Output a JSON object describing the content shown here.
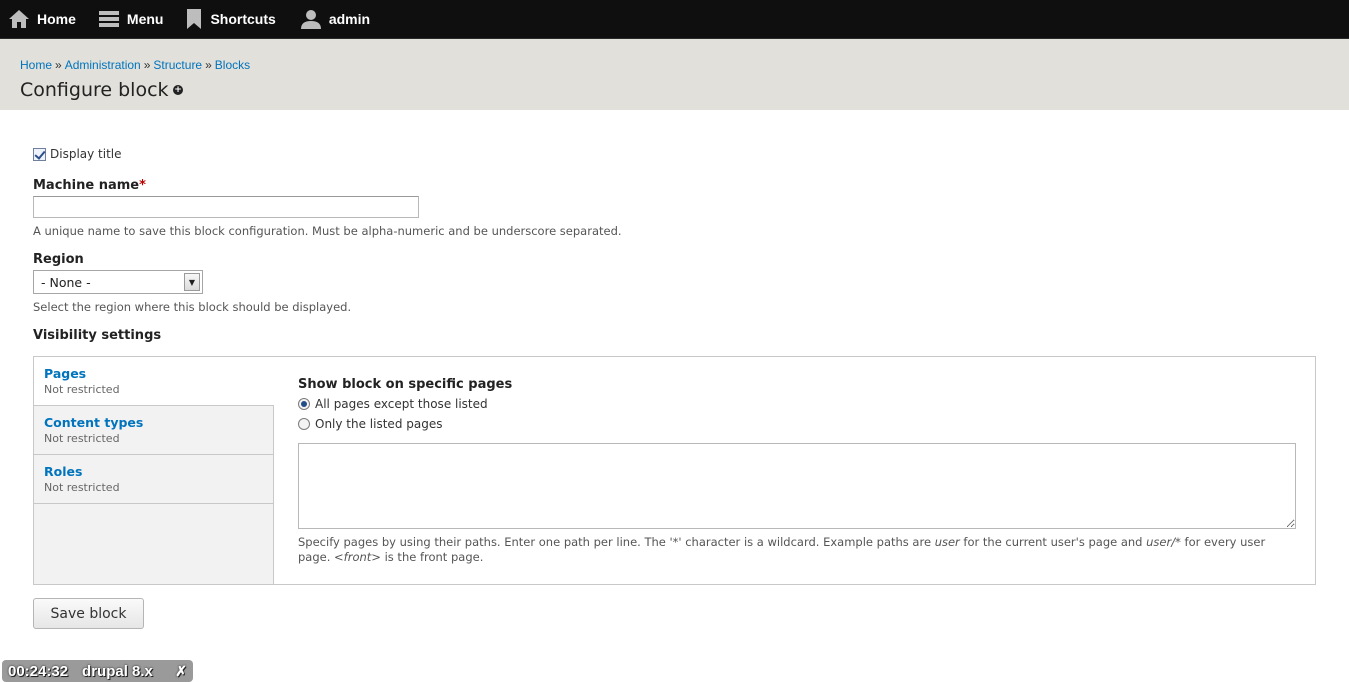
{
  "toolbar": {
    "home": "Home",
    "menu": "Menu",
    "shortcuts": "Shortcuts",
    "user": "admin"
  },
  "breadcrumb": [
    "Home",
    "Administration",
    "Structure",
    "Blocks"
  ],
  "breadcrumb_separator": "»",
  "page_title": "Configure block",
  "form": {
    "display_title_label": "Display title",
    "display_title_checked": true,
    "machine_name_label": "Machine name",
    "required_marker": "*",
    "machine_name_value": "",
    "machine_name_desc": "A unique name to save this block configuration. Must be alpha-numeric and be underscore separated.",
    "region_label": "Region",
    "region_value": "- None -",
    "region_desc": "Select the region where this block should be displayed.",
    "visibility_label": "Visibility settings"
  },
  "vtabs": [
    {
      "title": "Pages",
      "summary": "Not restricted"
    },
    {
      "title": "Content types",
      "summary": "Not restricted"
    },
    {
      "title": "Roles",
      "summary": "Not restricted"
    }
  ],
  "pane": {
    "title": "Show block on specific pages",
    "options": [
      "All pages except those listed",
      "Only the listed pages"
    ],
    "selected_option": 0,
    "desc_parts": {
      "a": "Specify pages by using their paths. Enter one path per line. The '*' character is a wildcard. Example paths are ",
      "b": "user",
      "c": " for the current user's page and ",
      "d": "user/*",
      "e": " for every user page. ",
      "f": "<front>",
      "g": " is the front page."
    }
  },
  "save_label": "Save block",
  "recorder": {
    "time": "00:24:32",
    "name": "drupal 8.x",
    "close": "✗"
  },
  "colors": {
    "toolbar_bg": "#0f0f0f",
    "header_bg": "#e1e0da",
    "link": "#0074bd"
  }
}
